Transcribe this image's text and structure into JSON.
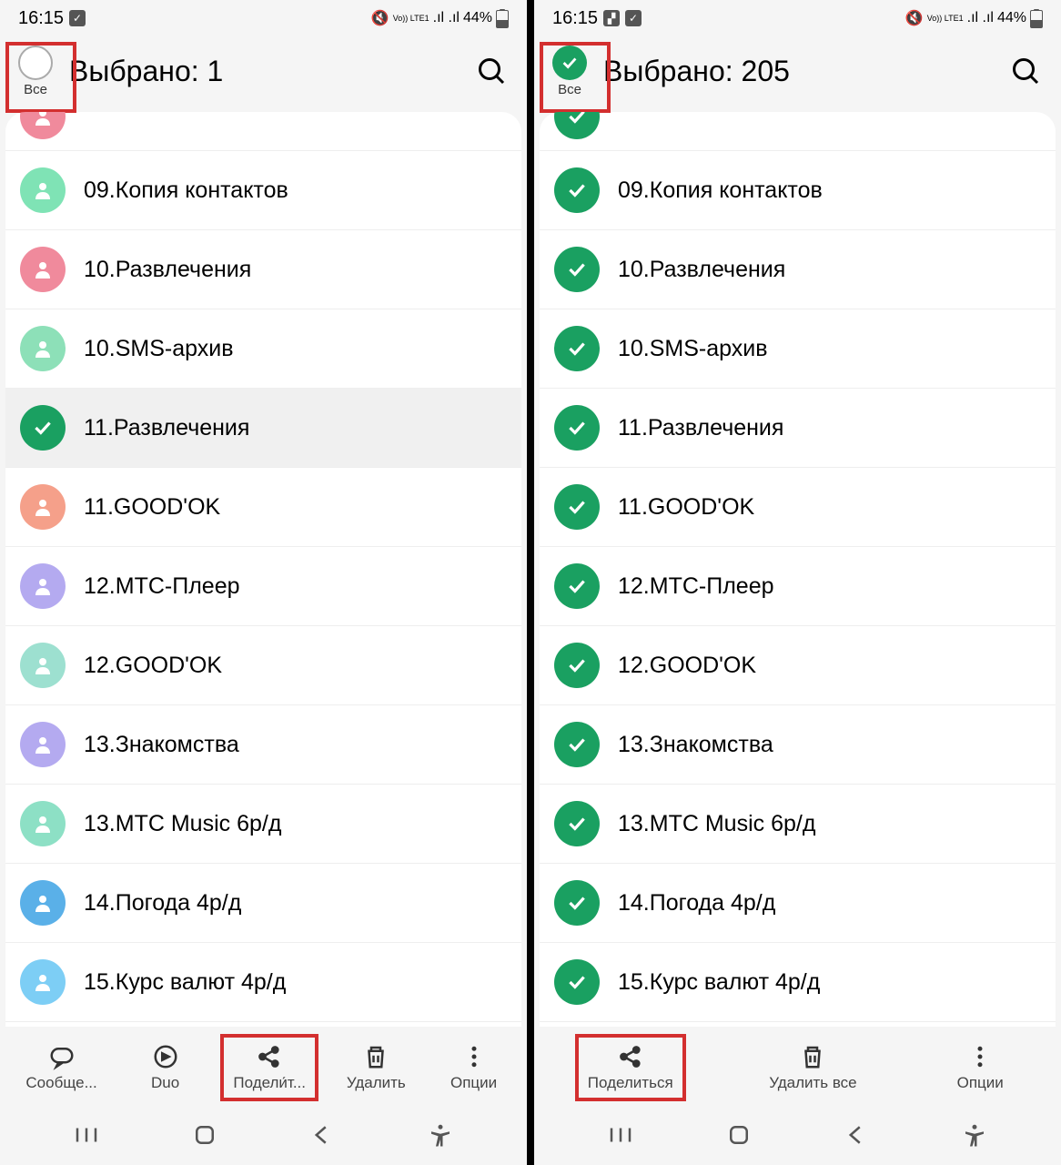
{
  "status": {
    "time": "16:15",
    "battery": "44%",
    "volte": "Vo))\nLTE1",
    "signal": ".ıl .ıl"
  },
  "left": {
    "selectAllLabel": "Все",
    "headerTitle": "Выбрано: 1",
    "items": [
      {
        "name": "",
        "color": "#f08a9c",
        "avatar": true,
        "checked": false,
        "cut": true
      },
      {
        "name": "09.Копия контактов",
        "color": "#7fe3b5",
        "avatar": true,
        "checked": false
      },
      {
        "name": "10.Развлечения",
        "color": "#f08a9c",
        "avatar": true,
        "checked": false
      },
      {
        "name": "10.SMS-архив",
        "color": "#8de0b8",
        "avatar": true,
        "checked": false
      },
      {
        "name": "11.Развлечения",
        "color": "",
        "avatar": false,
        "checked": true,
        "sel": true
      },
      {
        "name": "11.GOOD'OK",
        "color": "#f5a08a",
        "avatar": true,
        "checked": false
      },
      {
        "name": "12.МТС-Плеер",
        "color": "#b4aaf0",
        "avatar": true,
        "checked": false
      },
      {
        "name": "12.GOOD'OK",
        "color": "#9de0d0",
        "avatar": true,
        "checked": false
      },
      {
        "name": "13.Знакомства",
        "color": "#b4aaf0",
        "avatar": true,
        "checked": false
      },
      {
        "name": "13.MTC Music 6р/д",
        "color": "#8de0c5",
        "avatar": true,
        "checked": false
      },
      {
        "name": "14.Погода 4р/д",
        "color": "#5ab0e8",
        "avatar": true,
        "checked": false
      },
      {
        "name": "15.Курс валют 4р/д",
        "color": "#7dcef5",
        "avatar": true,
        "checked": false
      }
    ],
    "bottom": [
      {
        "label": "Сообще...",
        "icon": "msg"
      },
      {
        "label": "Duo",
        "icon": "duo"
      },
      {
        "label": "Подели́т...",
        "icon": "share",
        "highlight": true
      },
      {
        "label": "Удалить",
        "icon": "trash"
      },
      {
        "label": "Опции",
        "icon": "dots"
      }
    ]
  },
  "right": {
    "selectAllLabel": "Все",
    "headerTitle": "Выбрано: 205",
    "items": [
      {
        "name": "",
        "checked": true,
        "cut": true
      },
      {
        "name": "09.Копия контактов",
        "checked": true
      },
      {
        "name": "10.Развлечения",
        "checked": true
      },
      {
        "name": "10.SMS-архив",
        "checked": true
      },
      {
        "name": "11.Развлечения",
        "checked": true
      },
      {
        "name": "11.GOOD'OK",
        "checked": true
      },
      {
        "name": "12.МТС-Плеер",
        "checked": true
      },
      {
        "name": "12.GOOD'OK",
        "checked": true
      },
      {
        "name": "13.Знакомства",
        "checked": true
      },
      {
        "name": "13.MTC Music 6р/д",
        "checked": true
      },
      {
        "name": "14.Погода 4р/д",
        "checked": true
      },
      {
        "name": "15.Курс валют 4р/д",
        "checked": true
      }
    ],
    "bottom": [
      {
        "label": "Поделиться",
        "icon": "share",
        "highlight": true
      },
      {
        "label": "Удалить все",
        "icon": "trash"
      },
      {
        "label": "Опции",
        "icon": "dots"
      }
    ]
  }
}
